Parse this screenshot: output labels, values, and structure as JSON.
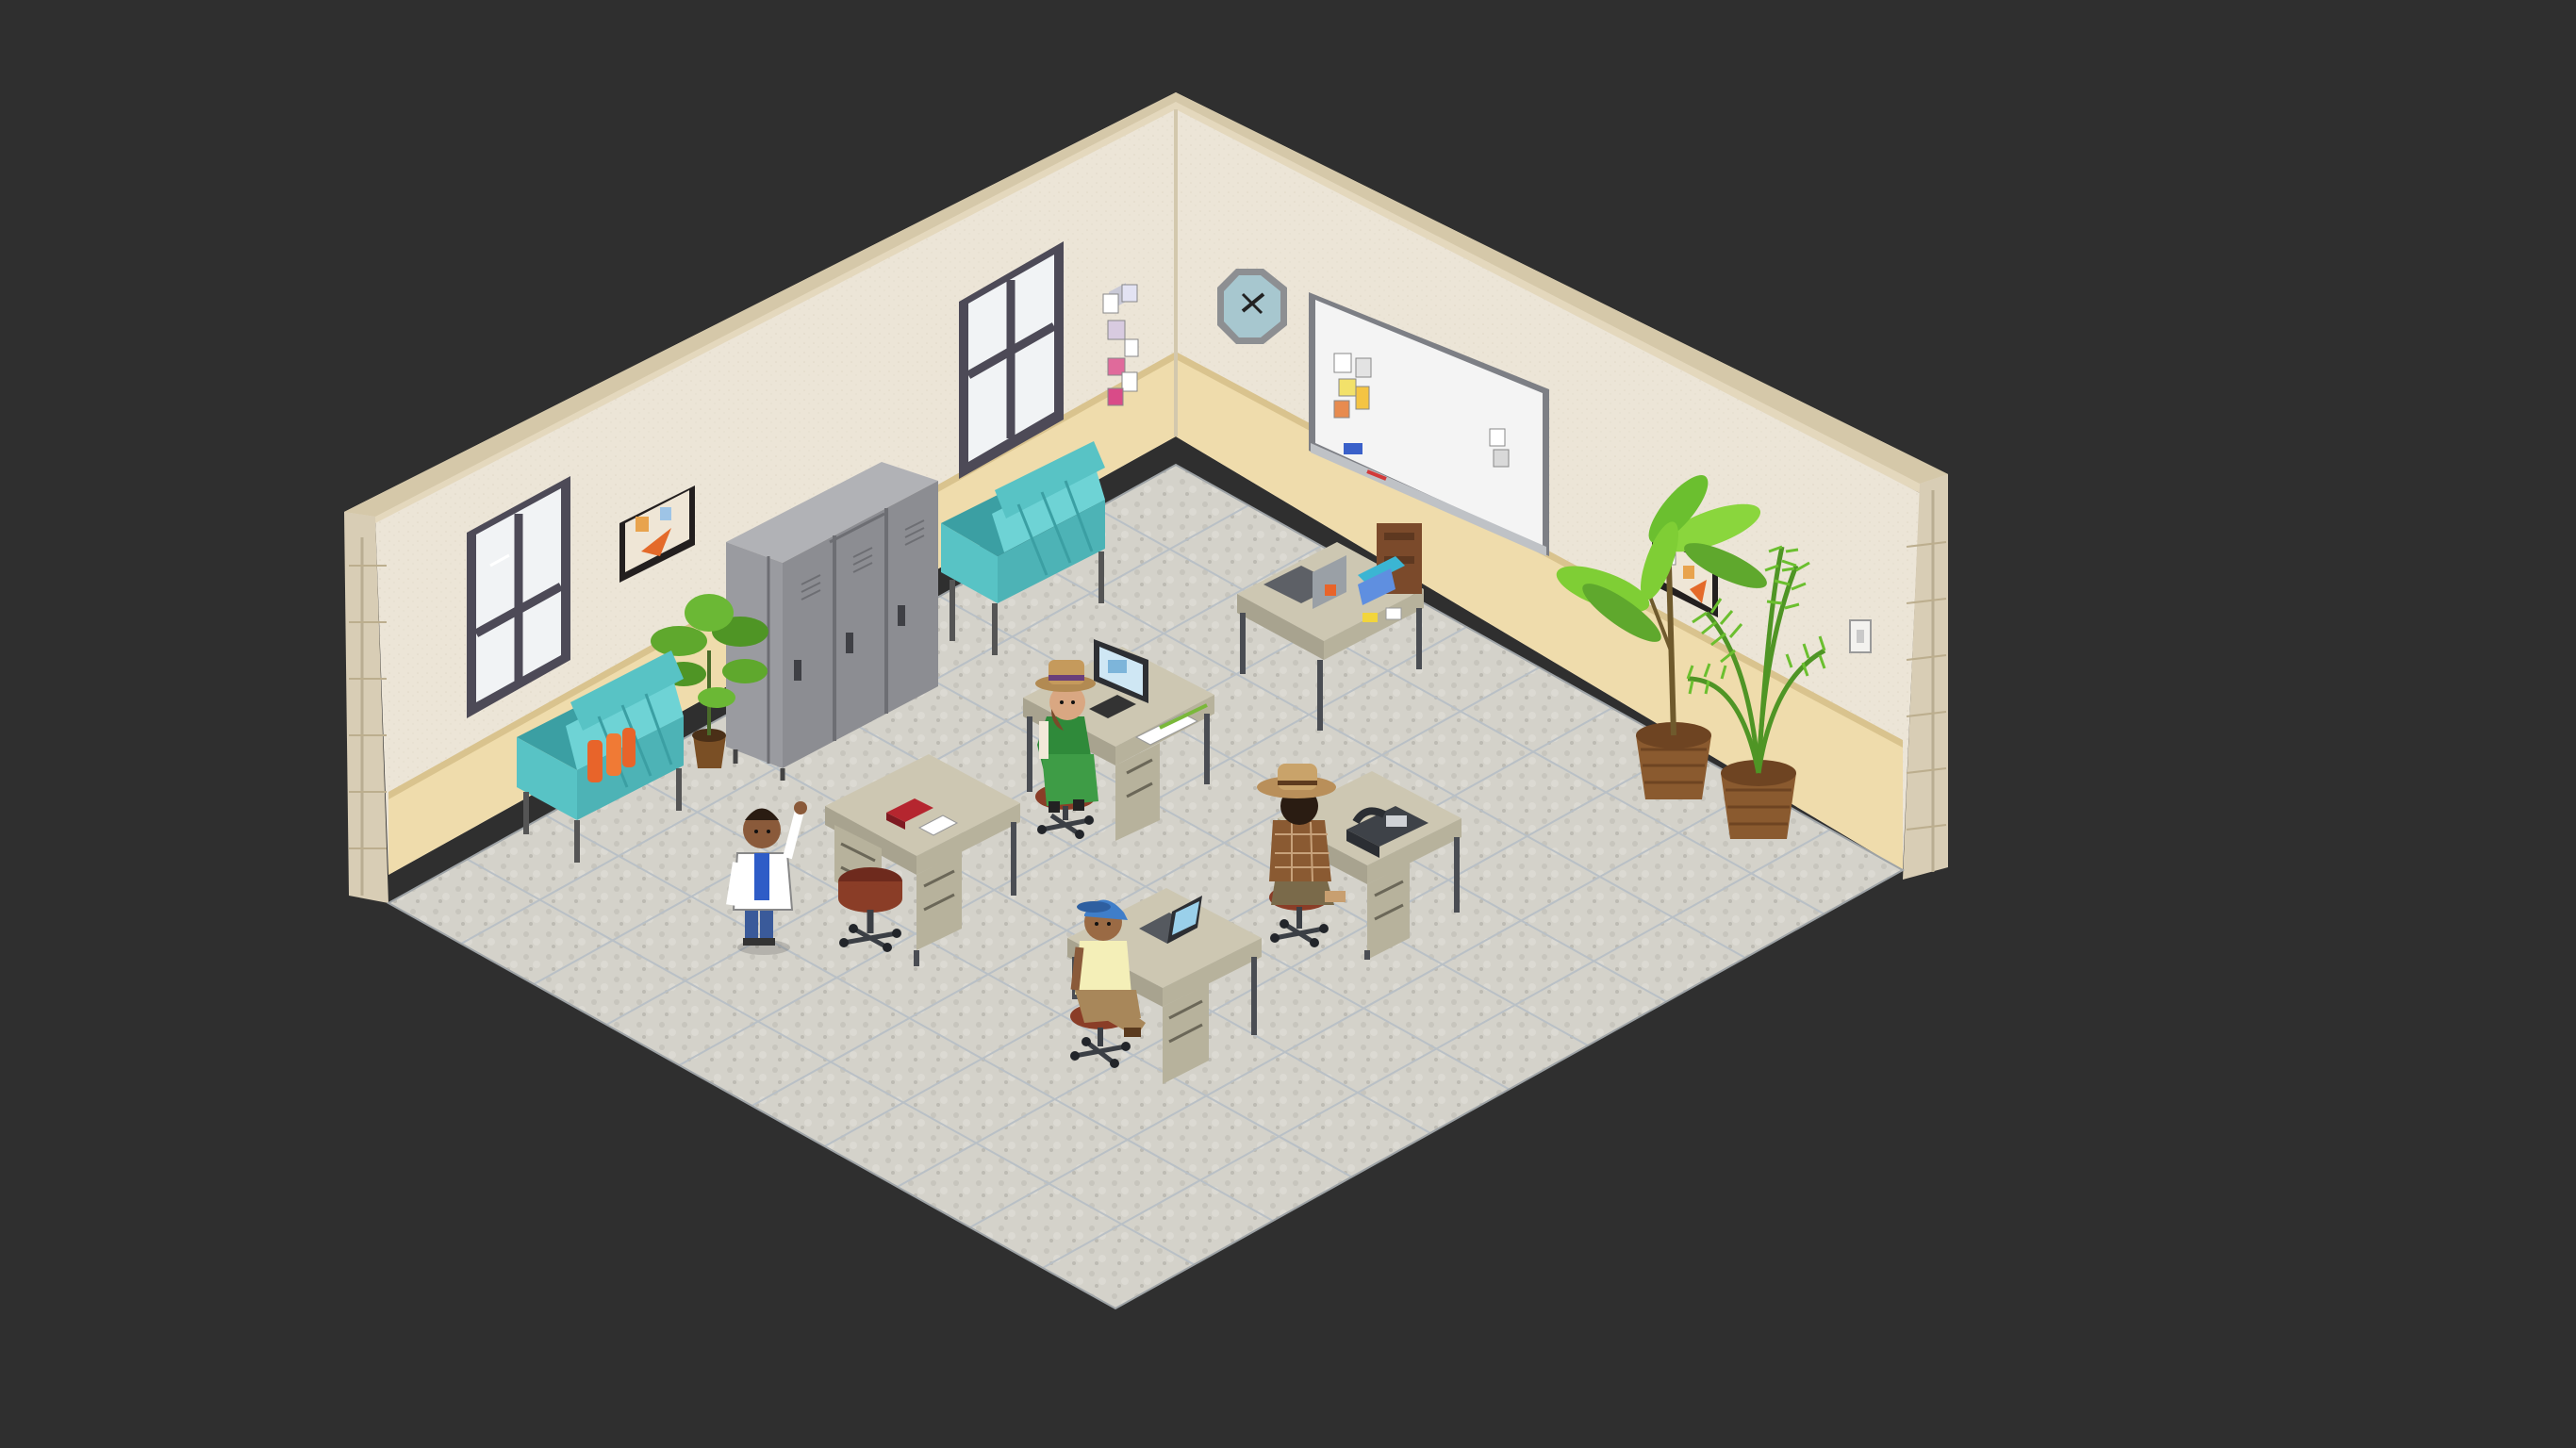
{
  "room": {
    "kind": "isometric-office",
    "colors": {
      "background": "#2f2f2f",
      "wall_face": "#ece5d7",
      "wall_left_face": "#e6dfd0",
      "wall_trim": "#d8cdb5",
      "wall_top": "#e7dcc4",
      "wainscot": "#efdcac",
      "floor": "#d4d2ca",
      "floor_grout": "#b9c0c6",
      "window_frame": "#4d4a57",
      "window_glass": "#f1f3f5",
      "sofa": "#58c3c5",
      "sofa_shade": "#3b9fa3",
      "locker": "#9a9ba0",
      "locker_shade": "#7b7c82",
      "desk_top": "#cdc7b2",
      "desk_side": "#a8a38f",
      "chair": "#8a3d27",
      "chair_base": "#3b3f45",
      "plant_leaf": "#5fa82d",
      "plant_pot": "#8a5a2f",
      "whiteboard": "#f4f4f4",
      "clock": "#a7c7cf"
    }
  },
  "furniture": {
    "windows": [
      "window-left",
      "window-center"
    ],
    "sofas": [
      "sofa-left",
      "sofa-back"
    ],
    "lockers": 3,
    "desks": [
      "desk-back",
      "desk-computer",
      "desk-red-book",
      "desk-phone",
      "desk-laptop"
    ],
    "plants": [
      "plant-small",
      "plant-tall",
      "plant-palm"
    ],
    "wall_items": [
      "clock",
      "whiteboard",
      "memo-board-left",
      "memo-board-right",
      "sticky-notes",
      "light-switch"
    ]
  },
  "avatars": [
    {
      "id": "waving-doctor",
      "icon": "avatar-white-coat-waving"
    },
    {
      "id": "green-dress-fedora",
      "icon": "avatar-fedora-seated"
    },
    {
      "id": "cowboy-hat",
      "icon": "avatar-cowboy-hat-seated"
    },
    {
      "id": "blue-cap",
      "icon": "avatar-blue-cap-seated"
    }
  ]
}
